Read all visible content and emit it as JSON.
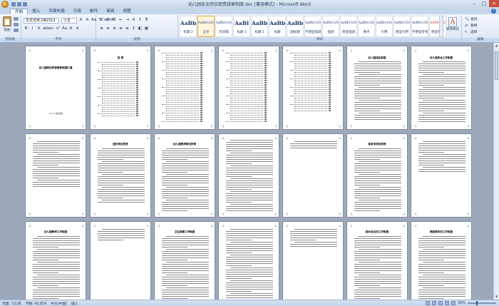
{
  "window": {
    "title": "幼儿园安全岗位职责规章制度.doc [兼容模式] - Microsoft Word",
    "controls": [
      "–",
      "□",
      "×"
    ]
  },
  "menu": {
    "tabs": [
      "开始",
      "插入",
      "页面布局",
      "引用",
      "邮件",
      "审阅",
      "视图"
    ],
    "active": "开始"
  },
  "ribbon": {
    "clipboard": {
      "paste_label": "粘贴",
      "group_label": "剪贴板"
    },
    "font": {
      "name": "华文仿宋,GB2312",
      "size": "小五",
      "group_label": "字体",
      "row1": [
        "A",
        "A",
        "Aa",
        "✎",
        "wén",
        "A"
      ],
      "row2": [
        "B",
        "I",
        "U",
        "abe",
        "x₂",
        "x²",
        "Aa",
        "A",
        "A"
      ]
    },
    "paragraph": {
      "group_label": "段落",
      "row1": [
        "☰",
        "☰",
        "☰",
        "⇤",
        "⇥",
        "A",
        "↕",
        "¶"
      ],
      "row2": [
        "≡",
        "≡",
        "≡",
        "≡",
        "≡",
        "↕",
        "◧",
        "▦"
      ]
    },
    "styles": {
      "group_label": "样式",
      "items": [
        {
          "preview": "AaBbC",
          "name": "标题 2"
        },
        {
          "preview": "AaBbCcDc",
          "name": "正文",
          "selected": true
        },
        {
          "preview": "AaBbCcDc",
          "name": "无间隔"
        },
        {
          "preview": "AaBl",
          "name": "标题 1"
        },
        {
          "preview": "AaBb",
          "name": "标题 2"
        },
        {
          "preview": "AaBbC",
          "name": "标题"
        },
        {
          "preview": "AaBbC",
          "name": "副标题"
        },
        {
          "preview": "AaBbCcDc",
          "name": "不明显强调"
        },
        {
          "preview": "AaBbCcDc",
          "name": "强调"
        },
        {
          "preview": "AaBbCcDc",
          "name": "明显强调"
        },
        {
          "preview": "AaBbCcDc",
          "name": "要点"
        },
        {
          "preview": "AaBbCcDc",
          "name": "引用"
        },
        {
          "preview": "AaBbCcDc",
          "name": "明显引用"
        },
        {
          "preview": "AaBbCcDc",
          "name": "不明显参考"
        },
        {
          "preview": "AABBCCDC",
          "name": "明显参考"
        }
      ]
    },
    "change_styles": {
      "label": "更改样式"
    },
    "editing": {
      "group_label": "编辑",
      "items": [
        {
          "icon": "find-icon",
          "label": "查找"
        },
        {
          "icon": "replace-icon",
          "label": "替换"
        },
        {
          "icon": "select-icon",
          "label": "选择"
        }
      ]
    }
  },
  "document": {
    "cover_title": "幼儿园岗位职责规章制度汇编",
    "cover_subtitle": "××××幼儿园",
    "toc_title": "目  录",
    "row2_titles": [
      "",
      "园长岗位职责",
      "幼儿园教师岗位职责",
      "",
      "",
      "保育员岗位职责",
      ""
    ],
    "row3_titles": [
      "幼儿园教师工作制度",
      "",
      "卫生保健工作制度",
      "",
      "",
      "园长会议的工作制度",
      "家园联系的工作制度"
    ],
    "row1_right_titles": [
      "幼儿园招生制度",
      "幼儿园安全工作制度"
    ]
  },
  "status": {
    "page": "页面: 7/138",
    "words": "字数: 43,814",
    "language": "中文(中国)",
    "mode": "插入",
    "zoom": "30%"
  }
}
